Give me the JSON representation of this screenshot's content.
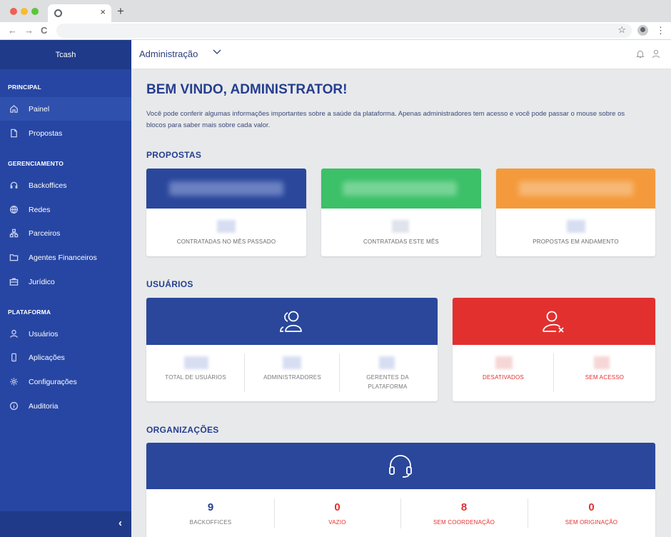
{
  "browser": {
    "tab_close": "×",
    "new_tab": "+",
    "back": "←",
    "forward": "→",
    "reload": "C",
    "star": "☆",
    "menu": "⋮"
  },
  "sidebar": {
    "brand": "Tcash",
    "sections": [
      {
        "title": "PRINCIPAL",
        "items": [
          {
            "label": "Painel",
            "icon": "home-icon",
            "active": true
          },
          {
            "label": "Propostas",
            "icon": "document-icon"
          }
        ]
      },
      {
        "title": "GERENCIAMENTO",
        "items": [
          {
            "label": "Backoffices",
            "icon": "headset-icon"
          },
          {
            "label": "Redes",
            "icon": "globe-icon"
          },
          {
            "label": "Parceiros",
            "icon": "hierarchy-icon"
          },
          {
            "label": "Agentes Financeiros",
            "icon": "folder-icon"
          },
          {
            "label": "Jurídico",
            "icon": "briefcase-icon"
          }
        ]
      },
      {
        "title": "PLATAFORMA",
        "items": [
          {
            "label": "Usuários",
            "icon": "user-icon"
          },
          {
            "label": "Aplicações",
            "icon": "mobile-icon"
          },
          {
            "label": "Configurações",
            "icon": "gear-icon"
          },
          {
            "label": "Auditoria",
            "icon": "info-icon"
          }
        ]
      }
    ],
    "collapse_glyph": "‹"
  },
  "header": {
    "title": "Administração"
  },
  "main": {
    "title": "BEM VINDO, ADMINISTRATOR!",
    "intro": "Você pode conferir algumas informações importantes sobre a saúde da plataforma. Apenas administradores tem acesso e você pode passar o mouse sobre os blocos para saber mais sobre cada valor.",
    "propostas": {
      "heading": "PROPOSTAS",
      "cards": [
        {
          "label": "CONTRATADAS NO MÊS PASSADO",
          "color": "#2a479b"
        },
        {
          "label": "CONTRATADAS ESTE MÊS",
          "color": "#3cc068"
        },
        {
          "label": "PROPOSTAS EM ANDAMENTO",
          "color": "#f49a3c"
        }
      ]
    },
    "usuarios": {
      "heading": "USUÁRIOS",
      "active_card": {
        "color": "#2a479b",
        "icon": "users-icon",
        "columns": [
          {
            "label": "TOTAL DE USUÁRIOS"
          },
          {
            "label": "ADMINISTRADORES"
          },
          {
            "label": "GERENTES DA PLATAFORMA"
          }
        ]
      },
      "inactive_card": {
        "color": "#e2302f",
        "icon": "user-x-icon",
        "columns": [
          {
            "label": "DESATIVADOS"
          },
          {
            "label": "SEM ACESSO"
          }
        ]
      }
    },
    "organizacoes": {
      "heading": "ORGANIZAÇÕES",
      "color": "#2a479b",
      "icon": "headset-icon",
      "columns": [
        {
          "value": "9",
          "label": "BACKOFFICES",
          "color": "#253e90",
          "label_color": "#777777"
        },
        {
          "value": "0",
          "label": "VAZIO",
          "color": "#e2302f",
          "label_color": "#e2302f"
        },
        {
          "value": "8",
          "label": "SEM COORDENAÇÃO",
          "color": "#e2302f",
          "label_color": "#e2302f"
        },
        {
          "value": "0",
          "label": "SEM ORIGINAÇÃO",
          "color": "#e2302f",
          "label_color": "#e2302f"
        }
      ]
    }
  }
}
